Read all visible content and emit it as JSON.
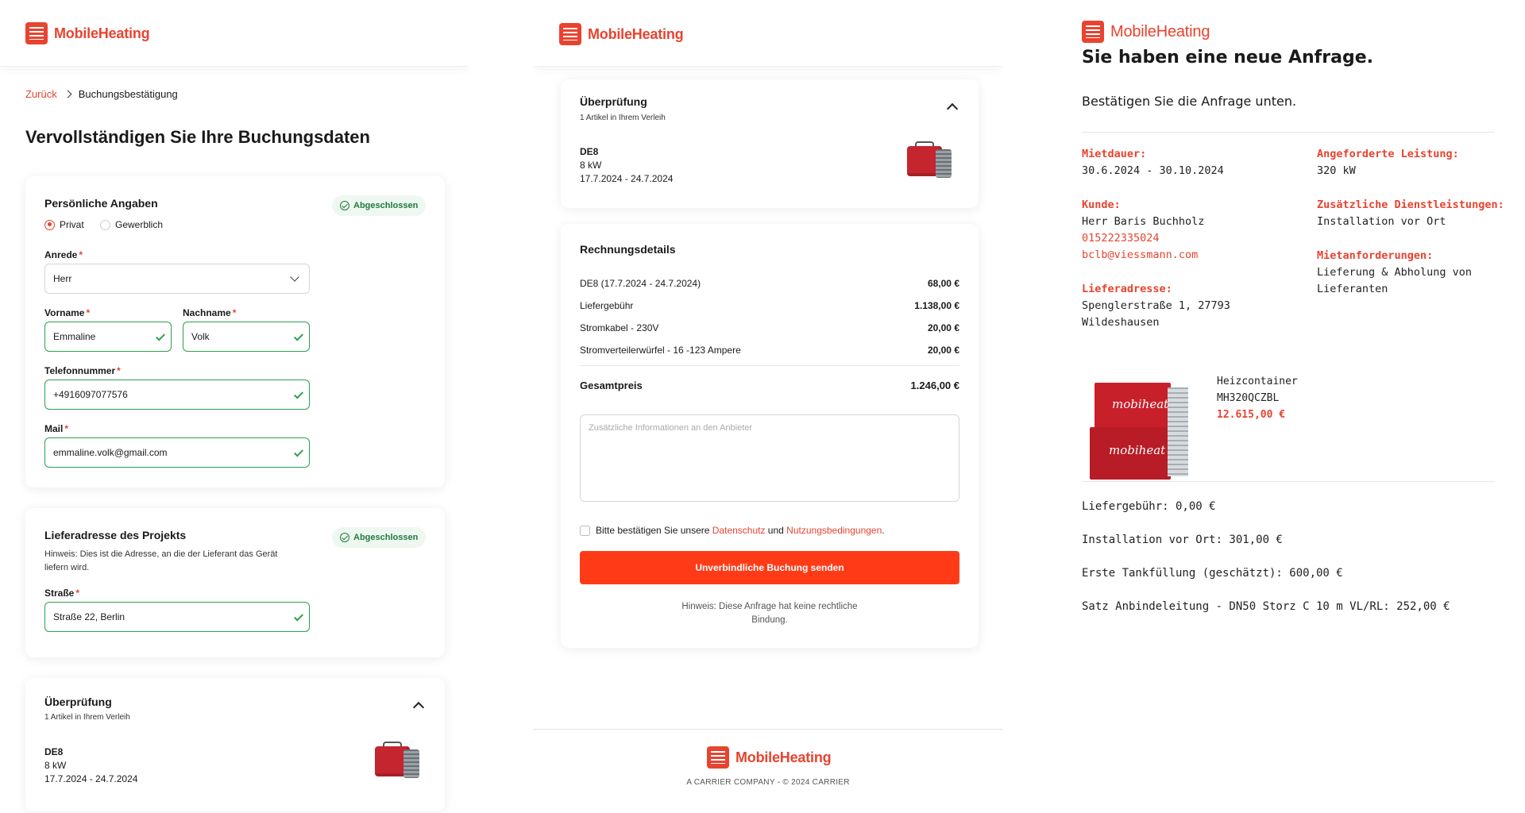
{
  "brand": {
    "name": "MobileHeating",
    "color": "#e8432f"
  },
  "left": {
    "breadcrumb": {
      "back": "Zurück",
      "current": "Buchungsbestätigung"
    },
    "page_title": "Vervollständigen Sie Ihre Buchungsdaten",
    "personal": {
      "title": "Persönliche Angaben",
      "status": "Abgeschlossen",
      "radio_private": "Privat",
      "radio_business": "Gewerblich",
      "salutation_label": "Anrede",
      "salutation_value": "Herr",
      "firstname_label": "Vorname",
      "firstname_value": "Emmaline",
      "lastname_label": "Nachname",
      "lastname_value": "Volk",
      "phone_label": "Telefonnummer",
      "phone_value": "+4916097077576",
      "mail_label": "Mail",
      "mail_value": "emmaline.volk@gmail.com"
    },
    "delivery": {
      "title": "Lieferadresse des Projekts",
      "status": "Abgeschlossen",
      "hint": "Hinweis: Dies ist die Adresse, an die der Lieferant das Gerät liefern wird.",
      "street_label": "Straße",
      "street_value": "Straße 22, Berlin"
    },
    "review": {
      "title": "Überprüfung",
      "subtitle": "1 Artikel in Ihrem Verleih",
      "item_name": "DE8",
      "item_power": "8 kW",
      "item_dates": "17.7.2024 - 24.7.2024"
    }
  },
  "middle": {
    "review": {
      "title": "Überprüfung",
      "subtitle": "1 Artikel in Ihrem Verleih",
      "item_name": "DE8",
      "item_power": "8 kW",
      "item_dates": "17.7.2024 - 24.7.2024"
    },
    "invoice": {
      "title": "Rechnungsdetails",
      "lines": [
        {
          "label": "DE8 (17.7.2024 - 24.7.2024)",
          "amount": "68,00 €"
        },
        {
          "label": "Liefergebühr",
          "amount": "1.138,00 €"
        },
        {
          "label": "Stromkabel - 230V",
          "amount": "20,00 €"
        },
        {
          "label": "Stromverteilerwürfel - 16 -123 Ampere",
          "amount": "20,00 €"
        }
      ],
      "total_label": "Gesamtpreis",
      "total_amount": "1.246,00 €",
      "notes_placeholder": "Zusätzliche Informationen an den Anbieter",
      "consent_prefix": "Bitte bestätigen Sie unsere ",
      "consent_privacy": "Datenschutz",
      "consent_and": " und ",
      "consent_terms": "Nutzungsbedingungen",
      "consent_suffix": ".",
      "submit": "Unverbindliche Buchung senden",
      "disclaimer": "Hinweis: Diese Anfrage hat keine rechtliche Bindung."
    },
    "footer": {
      "copyright": "A CARRIER COMPANY - © 2024 CARRIER"
    }
  },
  "right": {
    "headline": "Sie haben eine neue Anfrage.",
    "subline": "Bestätigen Sie die Anfrage unten.",
    "rental_label": "Mietdauer:",
    "rental_value": "30.6.2024 - 30.10.2024",
    "power_label": "Angeforderte Leistung:",
    "power_value": "320 kW",
    "customer_label": "Kunde:",
    "customer_name": "Herr Baris Buchholz",
    "customer_phone": "015222335024",
    "customer_mail": "bclb@viessmann.com",
    "services_label": "Zusätzliche Dienstleistungen:",
    "services_value": "Installation vor Ort",
    "requirements_label": "Mietanforderungen:",
    "requirements_value": "Lieferung & Abholung von Lieferanten",
    "address_label": "Lieferadresse:",
    "address_value": "Spenglerstraße 1, 27793 Wildeshausen",
    "product_name": "Heizcontainer",
    "product_code": "MH320QCZBL",
    "product_price": "12.615,00 €",
    "product_brand_text": "mobiheat",
    "fees": [
      "Liefergebühr: 0,00 €",
      "Installation vor Ort: 301,00 €",
      "Erste Tankfüllung (geschätzt): 600,00 €",
      "Satz Anbindeleitung - DN50 Storz C 10 m VL/RL: 252,00 €"
    ]
  }
}
